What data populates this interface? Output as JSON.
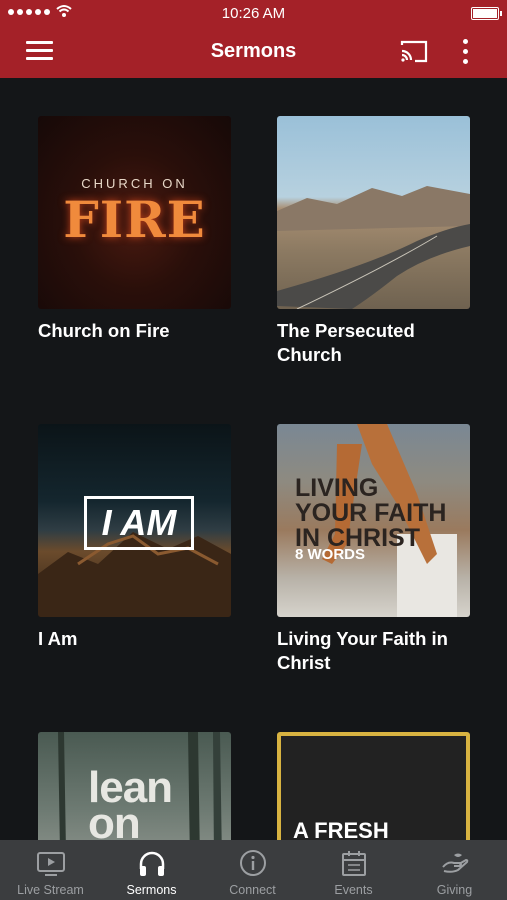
{
  "status_bar": {
    "time": "10:26 AM"
  },
  "nav": {
    "title": "Sermons"
  },
  "sermons": [
    {
      "title": "Church on Fire",
      "art_small": "CHURCH ON",
      "art_big": "FIRE"
    },
    {
      "title": "The Persecuted Church"
    },
    {
      "title": "I Am",
      "art_text": "I AM"
    },
    {
      "title": "Living Your Faith in Christ",
      "art_text": "LIVING YOUR FAITH IN CHRIST",
      "art_sub": "8 WORDS"
    },
    {
      "title": "",
      "art_text": "lean on"
    },
    {
      "title": "",
      "art_text": "A FRESH START"
    }
  ],
  "tabs": [
    {
      "label": "Live Stream",
      "icon": "tv-icon"
    },
    {
      "label": "Sermons",
      "icon": "headphones-icon"
    },
    {
      "label": "Connect",
      "icon": "info-icon"
    },
    {
      "label": "Events",
      "icon": "calendar-icon"
    },
    {
      "label": "Giving",
      "icon": "giving-hand-icon"
    }
  ],
  "colors": {
    "header": "#a42128",
    "background": "#141618",
    "tabbar": "#3b3d3f",
    "tab_active": "#ffffff",
    "tab_inactive": "#9c9fa2"
  }
}
